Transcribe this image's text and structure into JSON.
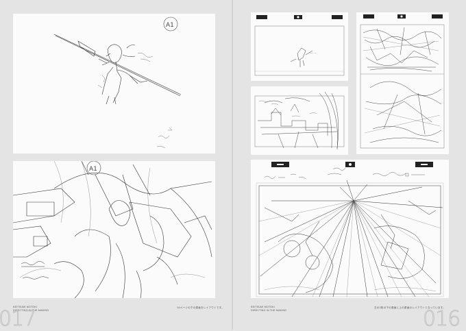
{
  "left_page": {
    "sheet_top": {
      "cut_label": "A1"
    },
    "sheet_bottom": {
      "cut_label": "A1"
    },
    "credit_line1": "KEITSUMI MOTOKI",
    "credit_line2": "DIRECTING IN THE MAKING",
    "caption": "1Aページの下の原画をレイアウトです。",
    "folio": "017"
  },
  "right_page": {
    "credit_line1": "KEITSUMI MOTOKI",
    "credit_line2": "DIRECTING IN THE MAKING",
    "caption": "左の2枚の下の原画と上の原画のレイアウトとなっています。",
    "folio": "016"
  }
}
